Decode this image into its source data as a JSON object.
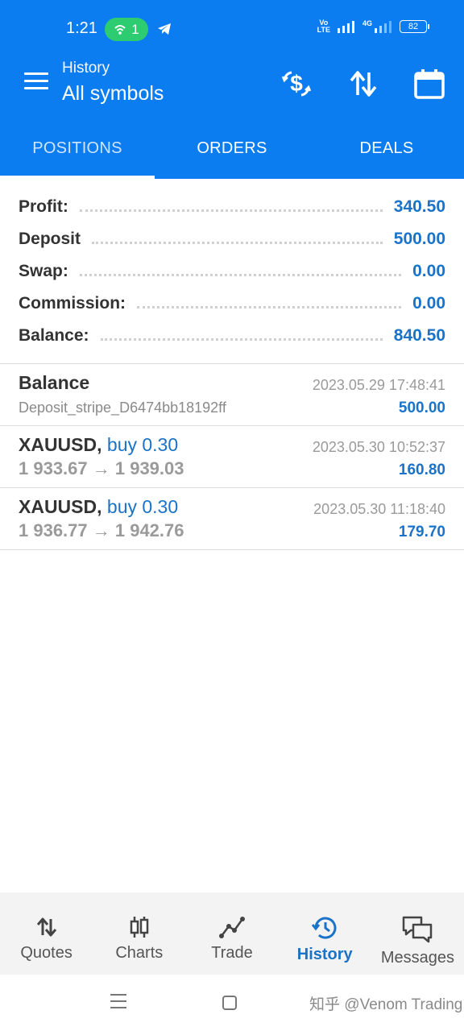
{
  "status_bar": {
    "time": "1:21",
    "hotspot_count": "1",
    "network": "4G",
    "volte_top": "Vo",
    "volte_bottom": "LTE",
    "battery": "82"
  },
  "app_bar": {
    "subtitle": "History",
    "title": "All symbols"
  },
  "tabs": [
    {
      "label": "POSITIONS",
      "active": true
    },
    {
      "label": "ORDERS",
      "active": false
    },
    {
      "label": "DEALS",
      "active": false
    }
  ],
  "summary": [
    {
      "label": "Profit:",
      "value": "340.50"
    },
    {
      "label": "Deposit",
      "value": "500.00"
    },
    {
      "label": "Swap:",
      "value": "0.00"
    },
    {
      "label": "Commission:",
      "value": "0.00"
    },
    {
      "label": "Balance:",
      "value": "840.50"
    }
  ],
  "deals": [
    {
      "title": "Balance",
      "side": "",
      "subtitle": "Deposit_stripe_D6474bb18192ff",
      "time": "2023.05.29 17:48:41",
      "profit": "500.00"
    },
    {
      "title": "XAUUSD,",
      "side": "buy 0.30",
      "subtitle": "1 933.67 → 1 939.03",
      "time": "2023.05.30 10:52:37",
      "profit": "160.80"
    },
    {
      "title": "XAUUSD,",
      "side": "buy 0.30",
      "subtitle": "1 936.77 → 1 942.76",
      "time": "2023.05.30 11:18:40",
      "profit": "179.70"
    }
  ],
  "bottom_nav": [
    {
      "label": "Quotes",
      "icon": "quotes-icon",
      "active": false
    },
    {
      "label": "Charts",
      "icon": "charts-icon",
      "active": false
    },
    {
      "label": "Trade",
      "icon": "trade-icon",
      "active": false
    },
    {
      "label": "History",
      "icon": "history-icon",
      "active": true
    },
    {
      "label": "Messages",
      "icon": "messages-icon",
      "active": false
    }
  ],
  "watermark": "知乎 @Venom Trading",
  "colors": {
    "primary": "#0b7df0",
    "accent_text": "#1a73c8",
    "hotspot": "#2ecc71"
  }
}
